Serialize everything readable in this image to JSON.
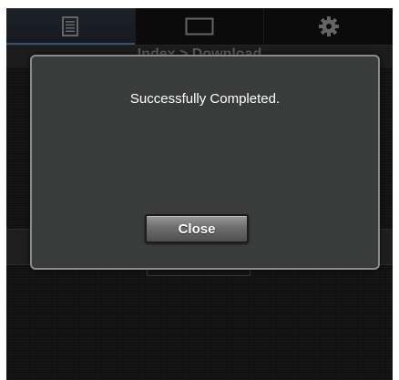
{
  "tabs": [
    {
      "icon": "document-list-icon",
      "active": true
    },
    {
      "icon": "screen-icon",
      "active": false
    },
    {
      "icon": "gear-icon",
      "active": false
    }
  ],
  "breadcrumb": "Index > Download",
  "dialog": {
    "message": "Successfully Completed.",
    "close_label": "Close"
  },
  "colors": {
    "background": "#1a1a1a",
    "dialog_bg": "#3a3b3b",
    "dialog_border": "#8a8c8c",
    "active_tab_accent": "#4a7fb5",
    "text": "#ffffff"
  }
}
